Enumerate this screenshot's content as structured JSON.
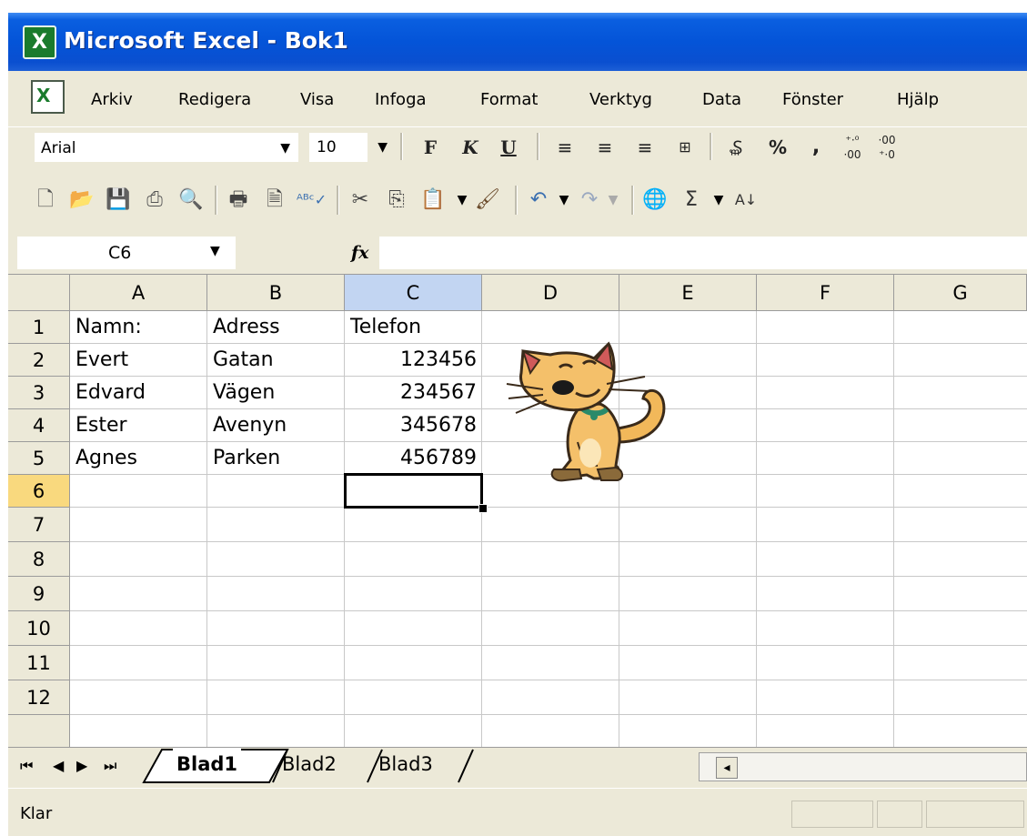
{
  "window": {
    "title": "Microsoft Excel - Bok1"
  },
  "menu": [
    "Arkiv",
    "Redigera",
    "Visa",
    "Infoga",
    "Format",
    "Verktyg",
    "Data",
    "Fönster",
    "Hjälp"
  ],
  "format_toolbar": {
    "font": "Arial",
    "size": "10",
    "bold_label": "F",
    "italic_label": "K",
    "underline_label": "U",
    "percent_label": "%",
    "comma_label": ","
  },
  "formula_bar": {
    "name_box": "C6",
    "fx_label": "fx",
    "formula": ""
  },
  "grid": {
    "columns": [
      "A",
      "B",
      "C",
      "D",
      "E",
      "F",
      "G"
    ],
    "selected_column": "C",
    "rows": [
      "1",
      "2",
      "3",
      "4",
      "5",
      "6",
      "7",
      "8",
      "9",
      "10",
      "11",
      "12"
    ],
    "selected_row": "6",
    "cells": [
      [
        "Namn:",
        "Adress",
        "Telefon"
      ],
      [
        "Evert",
        "Gatan",
        "123456"
      ],
      [
        "Edvard",
        "Vägen",
        "234567"
      ],
      [
        "Ester",
        "Avenyn",
        "345678"
      ],
      [
        "Agnes",
        "Parken",
        "456789"
      ]
    ],
    "active_cell": "C6"
  },
  "sheet_tabs": [
    "Blad1",
    "Blad2",
    "Blad3"
  ],
  "active_sheet": "Blad1",
  "status": {
    "text": "Klar"
  },
  "colors": {
    "titlebar": "#0454d8",
    "chrome": "#ece9d8",
    "selected_header": "#c2d5f2",
    "selected_row": "#f9d97e"
  }
}
